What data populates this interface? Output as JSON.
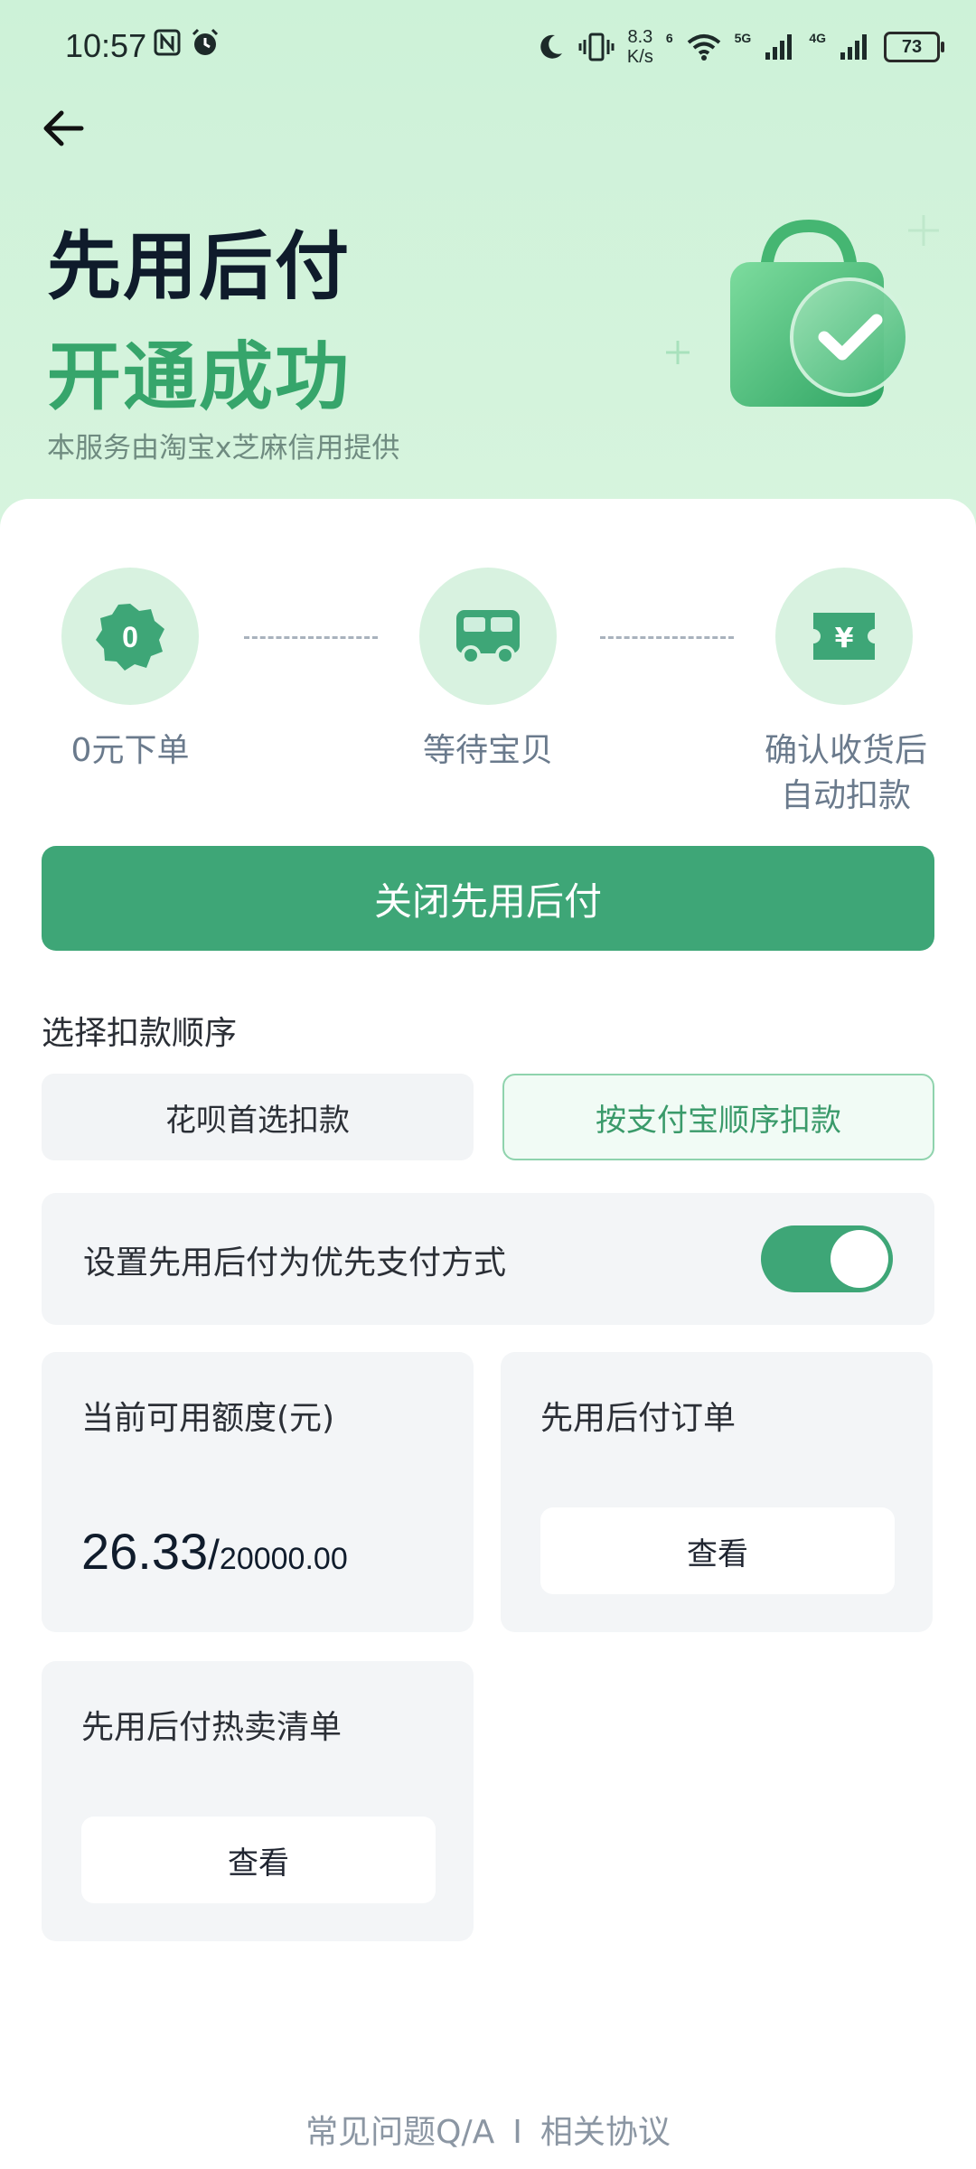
{
  "status_bar": {
    "time": "10:57",
    "speed_value": "8.3",
    "speed_unit": "K/s",
    "network_1": "6",
    "network_2": "5G",
    "network_3": "4G",
    "battery": "73"
  },
  "header": {
    "title_line1": "先用后付",
    "title_line2": "开通成功",
    "subtitle": "本服务由淘宝x芝麻信用提供"
  },
  "steps": [
    {
      "icon": "zero-badge-icon",
      "badge_text": "0",
      "label": "0元下单"
    },
    {
      "icon": "truck-icon",
      "label": "等待宝贝"
    },
    {
      "icon": "yuan-ticket-icon",
      "badge_text": "¥",
      "label_line1": "确认收货后",
      "label_line2": "自动扣款"
    }
  ],
  "close_button": "关闭先用后付",
  "deduction": {
    "label": "选择扣款顺序",
    "options": [
      "花呗首选扣款",
      "按支付宝顺序扣款"
    ],
    "selected": "按支付宝顺序扣款"
  },
  "preference": {
    "label": "设置先用后付为优先支付方式",
    "enabled": true
  },
  "credit": {
    "title": "当前可用额度(元)",
    "available": "26.33",
    "separator": "/",
    "total": "20000.00"
  },
  "orders": {
    "title": "先用后付订单",
    "view_label": "查看"
  },
  "hot_list": {
    "title": "先用后付热卖清单",
    "view_label": "查看"
  },
  "footer": {
    "faq": "常见问题Q/A",
    "separator": "I",
    "agreement": "相关协议"
  },
  "colors": {
    "primary": "#3ea677",
    "hero_bg": "#cdf2d8",
    "title_green": "#36a56b"
  }
}
